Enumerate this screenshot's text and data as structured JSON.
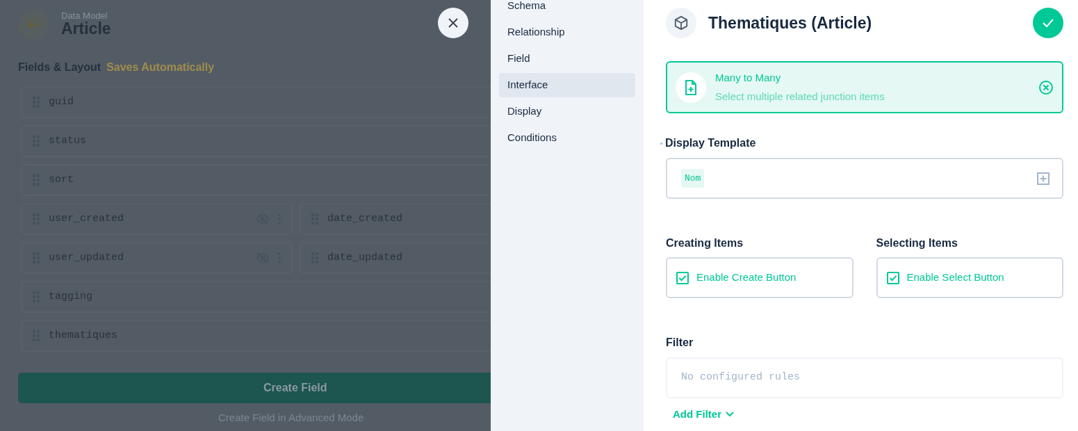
{
  "page": {
    "eyebrow": "Data Model",
    "title": "Article",
    "section_title": "Fields & Layout",
    "section_note": "Saves Automatically"
  },
  "field_rows": [
    [
      {
        "name": "guid"
      }
    ],
    [
      {
        "name": "status"
      }
    ],
    [
      {
        "name": "sort"
      }
    ],
    [
      {
        "name": "user_created",
        "hidden": true
      },
      {
        "name": "date_created"
      }
    ],
    [
      {
        "name": "user_updated",
        "hidden": true
      },
      {
        "name": "date_updated"
      }
    ],
    [
      {
        "name": "tagging"
      }
    ],
    [
      {
        "name": "thematiques"
      }
    ]
  ],
  "create_button": "Create Field",
  "advanced_link": "Create Field in Advanced Mode",
  "drawer_nav": [
    {
      "label": "Schema",
      "selected": false
    },
    {
      "label": "Relationship",
      "selected": false
    },
    {
      "label": "Field",
      "selected": false
    },
    {
      "label": "Interface",
      "selected": true
    },
    {
      "label": "Display",
      "selected": false
    },
    {
      "label": "Conditions",
      "selected": false
    }
  ],
  "drawer": {
    "title": "Thematiques (Article)",
    "interface_card": {
      "title": "Many to Many",
      "subtitle": "Select multiple related junction items"
    },
    "display_template": {
      "label": "Display Template",
      "tokens": [
        "Nom"
      ]
    },
    "options": [
      {
        "label": "Creating Items",
        "checkbox": "Enable Create Button",
        "checked": true
      },
      {
        "label": "Selecting Items",
        "checkbox": "Enable Select Button",
        "checked": true
      }
    ],
    "filter": {
      "label": "Filter",
      "empty_text": "No configured rules",
      "add_button": "Add Filter"
    }
  }
}
